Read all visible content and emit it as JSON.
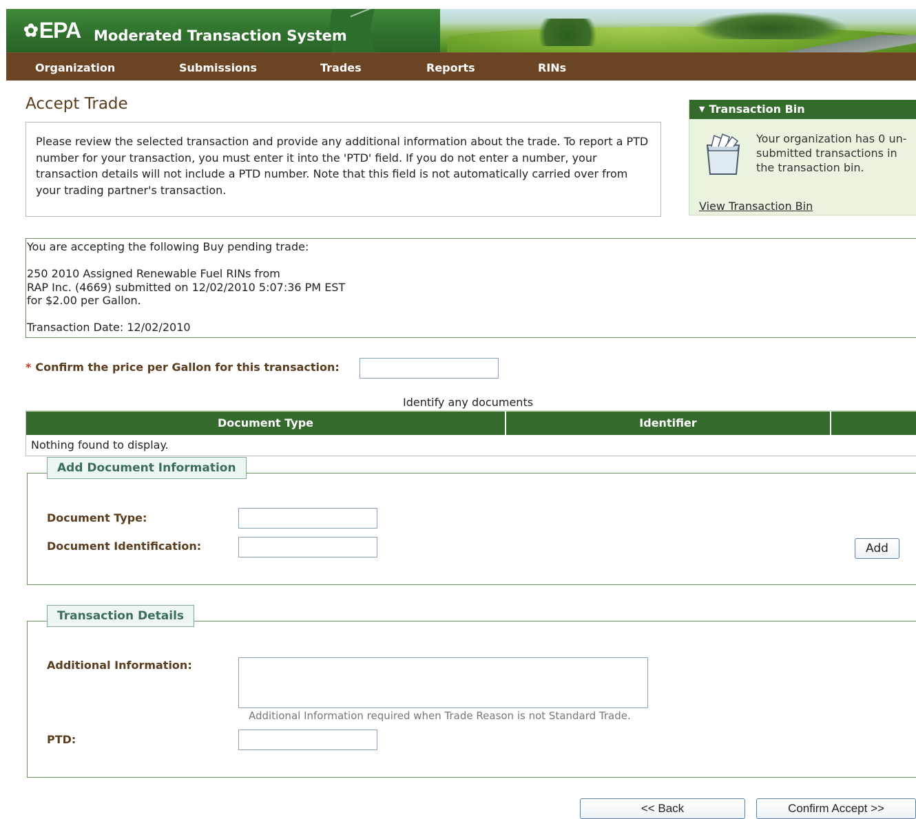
{
  "header": {
    "logo_text": "EPA",
    "app_title": "Moderated Transaction System"
  },
  "nav": {
    "items": [
      {
        "label": "Organization"
      },
      {
        "label": "Submissions"
      },
      {
        "label": "Trades"
      },
      {
        "label": "Reports"
      },
      {
        "label": "RINs"
      }
    ]
  },
  "page": {
    "title": "Accept Trade",
    "intro": "Please review the selected transaction and provide any additional information about the trade. To report a PTD number for your transaction, you must enter it into the 'PTD' field. If you do not enter a number, your transaction details will not include a PTD number. Note that this field is not automatically carried over from your trading partner's transaction."
  },
  "transaction_bin": {
    "header": "Transaction Bin",
    "message": "Your organization has 0 un-submitted transactions in the transaction bin.",
    "link": "View Transaction Bin",
    "icon": "basket-icon"
  },
  "trade": {
    "line1": "You are accepting the following Buy pending trade:",
    "line2": "250 2010 Assigned Renewable Fuel RINs from",
    "line3": "RAP Inc. (4669) submitted on 12/02/2010 5:07:36 PM EST",
    "line4": "for $2.00 per Gallon.",
    "line5": "Transaction Date: 12/02/2010"
  },
  "price_confirm": {
    "required_mark": "*",
    "label": "Confirm the price per Gallon for this transaction:",
    "value": ""
  },
  "documents": {
    "caption": "Identify any documents",
    "columns": [
      "Document Type",
      "Identifier",
      ""
    ],
    "empty_text": "Nothing found to display."
  },
  "add_document": {
    "legend": "Add Document Information",
    "type_label": "Document Type:",
    "type_value": "",
    "id_label": "Document Identification:",
    "id_value": "",
    "add_button": "Add"
  },
  "transaction_details": {
    "legend": "Transaction Details",
    "addl_label": "Additional Information:",
    "addl_value": "",
    "addl_hint": "Additional Information required when Trade Reason is not Standard Trade.",
    "ptd_label": "PTD:",
    "ptd_value": ""
  },
  "buttons": {
    "back": "<< Back",
    "confirm": "Confirm Accept >>"
  },
  "colors": {
    "header_green": "#2f6f2d",
    "nav_brown": "#6b4423",
    "label_brown": "#5a3c1e",
    "table_green": "#346b2c",
    "bin_bg": "#eaf3df"
  }
}
